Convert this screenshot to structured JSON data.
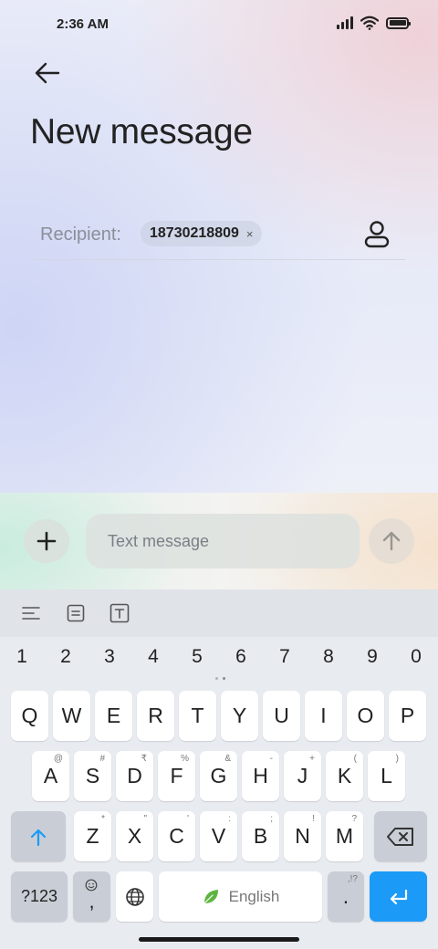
{
  "status_bar": {
    "time": "2:36 AM"
  },
  "header": {
    "title": "New message"
  },
  "recipient": {
    "label": "Recipient:",
    "chip_number": "18730218809",
    "chip_remove": "×"
  },
  "composer": {
    "placeholder": "Text message"
  },
  "keyboard": {
    "numbers": [
      "1",
      "2",
      "3",
      "4",
      "5",
      "6",
      "7",
      "8",
      "9",
      "0"
    ],
    "row1": [
      "Q",
      "W",
      "E",
      "R",
      "T",
      "Y",
      "U",
      "I",
      "O",
      "P"
    ],
    "row2": [
      {
        "key": "A",
        "sub": "@"
      },
      {
        "key": "S",
        "sub": "#"
      },
      {
        "key": "D",
        "sub": "₹"
      },
      {
        "key": "F",
        "sub": "%"
      },
      {
        "key": "G",
        "sub": "&"
      },
      {
        "key": "H",
        "sub": "-"
      },
      {
        "key": "J",
        "sub": "+"
      },
      {
        "key": "K",
        "sub": "("
      },
      {
        "key": "L",
        "sub": ")"
      }
    ],
    "row3": [
      {
        "key": "Z",
        "sub": "*"
      },
      {
        "key": "X",
        "sub": "\""
      },
      {
        "key": "C",
        "sub": "'"
      },
      {
        "key": "V",
        "sub": ":"
      },
      {
        "key": "B",
        "sub": ";"
      },
      {
        "key": "N",
        "sub": "!"
      },
      {
        "key": "M",
        "sub": "?"
      }
    ],
    "symbols_key": "?123",
    "comma_key": ",",
    "space_label": "English",
    "period_key": ".",
    "period_sub": ",!?",
    "accent_color": "#1b9af7"
  },
  "icons": [
    "back-arrow-icon",
    "contact-icon",
    "plus-icon",
    "send-arrow-icon",
    "shift-icon",
    "backspace-icon",
    "emoji-icon",
    "globe-icon",
    "leaf-icon",
    "enter-icon"
  ]
}
